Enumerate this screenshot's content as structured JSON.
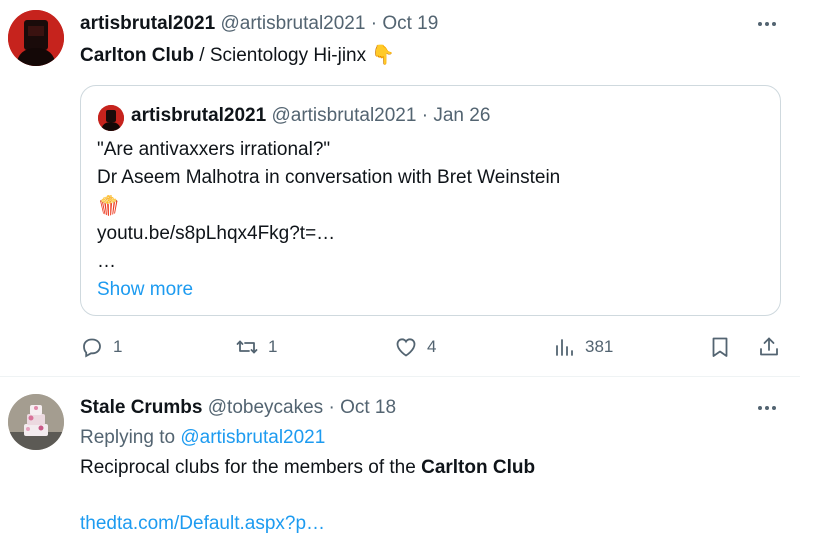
{
  "tweets": [
    {
      "author_name": "artisbrutal2021",
      "handle": "@artisbrutal2021",
      "date": "Oct 19",
      "text_bold": "Carlton Club",
      "text_rest": " / Scientology Hi-jinx ",
      "emoji": "👇",
      "quote": {
        "author_name": "artisbrutal2021",
        "handle": "@artisbrutal2021",
        "date": "Jan 26",
        "lines": [
          "\"Are antivaxxers irrational?\"",
          "Dr Aseem Malhotra in conversation with Bret Weinstein",
          "🍿",
          "youtu.be/s8pLhqx4Fkg?t=…",
          "…"
        ],
        "show_more": "Show more"
      },
      "stats": {
        "replies": "1",
        "retweets": "1",
        "likes": "4",
        "views": "381"
      }
    },
    {
      "author_name": "Stale Crumbs",
      "handle": "@tobeycakes",
      "date": "Oct 18",
      "replying_prefix": "Replying to ",
      "replying_to": "@artisbrutal2021",
      "text_pre": "Reciprocal clubs for the members of the ",
      "text_bold": "Carlton Club",
      "link": "thedta.com/Default.aspx?p…"
    }
  ],
  "dot": " · ",
  "icons": {
    "more": "more-horizontal-icon",
    "reply": "reply-icon",
    "retweet": "retweet-icon",
    "like": "heart-icon",
    "views": "bar-chart-icon",
    "bookmark": "bookmark-icon",
    "share": "share-icon"
  },
  "colors": {
    "text": "#0f1419",
    "secondary": "#536471",
    "link": "#1d9bf0",
    "border": "#cfd9de"
  }
}
